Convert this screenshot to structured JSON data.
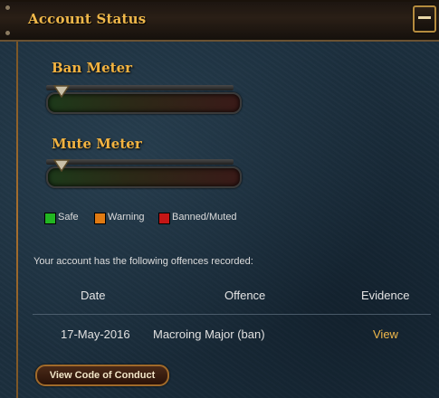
{
  "header": {
    "title": "Account Status"
  },
  "ban_meter": {
    "title": "Ban Meter",
    "level_percent": 0
  },
  "mute_meter": {
    "title": "Mute Meter",
    "level_percent": 0
  },
  "legend": [
    {
      "label": "Safe",
      "color": "#22b622"
    },
    {
      "label": "Warning",
      "color": "#e07a12"
    },
    {
      "label": "Banned/Muted",
      "color": "#c41616"
    }
  ],
  "offences": {
    "intro": "Your account has the following offences recorded:",
    "columns": [
      "Date",
      "Offence",
      "Evidence"
    ],
    "rows": [
      {
        "date": "17-May-2016",
        "offence": "Macroing Major (ban)",
        "evidence": "View"
      }
    ]
  },
  "footer": {
    "code_of_conduct_label": "View Code of Conduct"
  },
  "colors": {
    "accent": "#f0b84a",
    "border": "#b58b3e"
  }
}
